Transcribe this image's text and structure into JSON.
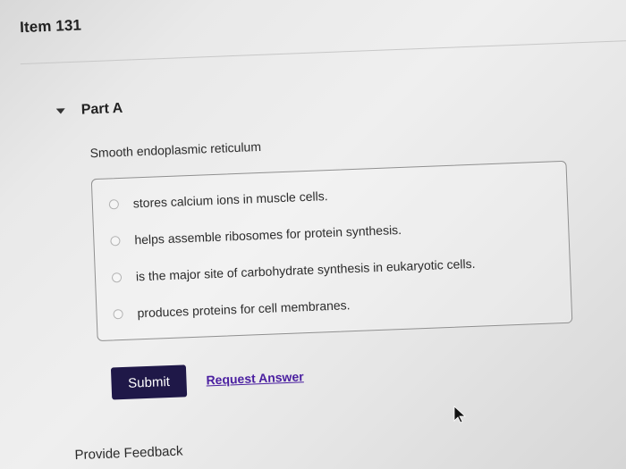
{
  "item": {
    "title": "Item 131"
  },
  "part": {
    "title": "Part A",
    "expanded_icon": "caret-down"
  },
  "question": {
    "prompt": "Smooth endoplasmic reticulum",
    "choices": [
      {
        "label": "stores calcium ions in muscle cells."
      },
      {
        "label": "helps assemble ribosomes for protein synthesis."
      },
      {
        "label": "is the major site of carbohydrate synthesis in eukaryotic cells."
      },
      {
        "label": "produces proteins for cell membranes."
      }
    ]
  },
  "actions": {
    "submit_label": "Submit",
    "request_answer_label": "Request Answer"
  },
  "footer": {
    "feedback_label": "Provide Feedback"
  },
  "icons": {
    "caret": "caret-down-icon",
    "radio": "radio-button-icon",
    "cursor": "mouse-cursor-icon"
  },
  "colors": {
    "submit_background": "#1f1848",
    "request_link": "#4a1fa0",
    "border": "#8f8f8f"
  }
}
